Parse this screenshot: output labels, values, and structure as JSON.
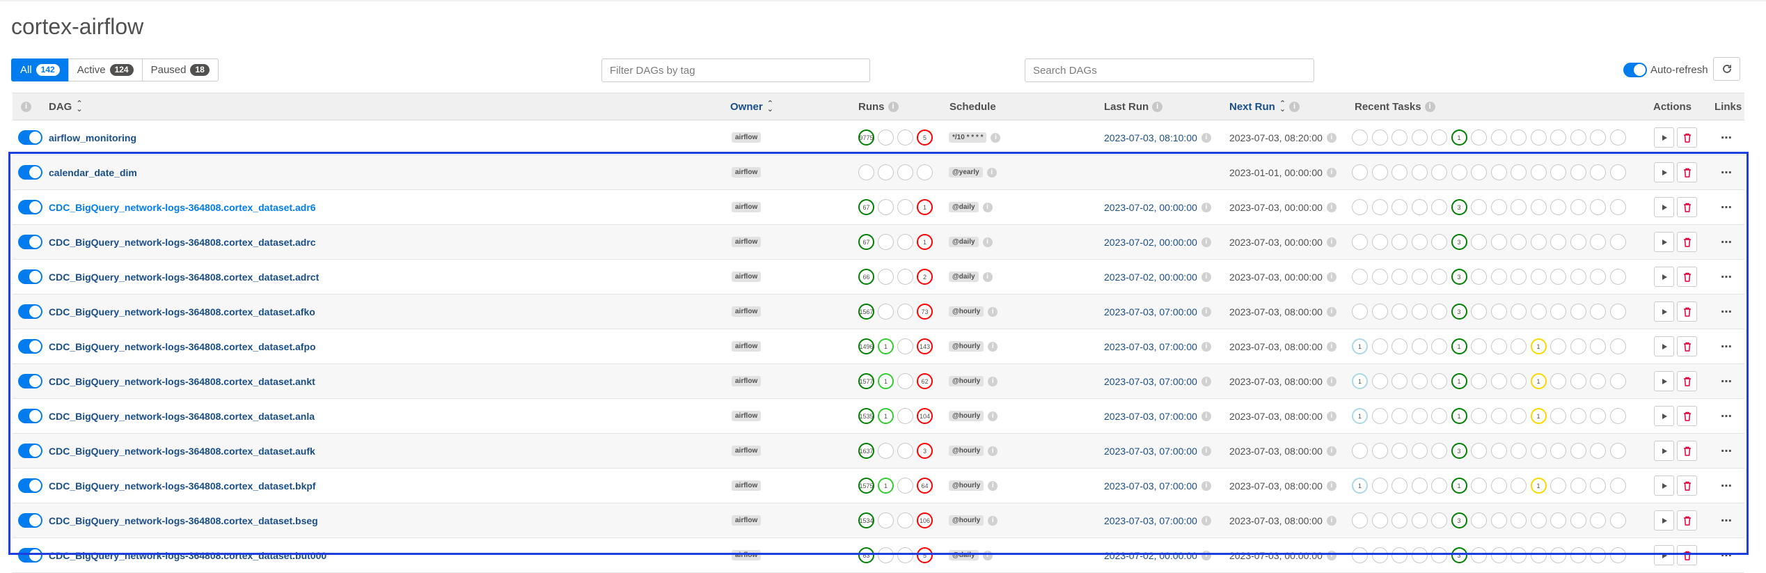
{
  "app": {
    "title": "cortex-airflow"
  },
  "filters": {
    "tabs": [
      {
        "label": "All",
        "count": "142",
        "active": true
      },
      {
        "label": "Active",
        "count": "124",
        "active": false
      },
      {
        "label": "Paused",
        "count": "18",
        "active": false
      }
    ],
    "tag_placeholder": "Filter DAGs by tag",
    "search_placeholder": "Search DAGs",
    "auto_refresh_label": "Auto-refresh"
  },
  "table": {
    "headers": {
      "dag": "DAG",
      "owner": "Owner",
      "runs": "Runs",
      "schedule": "Schedule",
      "last_run": "Last Run",
      "next_run": "Next Run",
      "recent_tasks": "Recent Tasks",
      "actions": "Actions",
      "links": "Links"
    },
    "rows": [
      {
        "dag": "airflow_monitoring",
        "owner": "airflow",
        "runs": [
          [
            "green",
            "9775"
          ],
          [
            "empty",
            ""
          ],
          [
            "empty",
            ""
          ],
          [
            "red",
            "5"
          ]
        ],
        "schedule": "*/10 * * * *",
        "last_run": "2023-07-03, 08:10:00",
        "next_run": "2023-07-03, 08:20:00",
        "tasks": [
          [
            5,
            "green",
            "1"
          ]
        ]
      },
      {
        "dag": "calendar_date_dim",
        "owner": "airflow",
        "runs": [
          [
            "empty",
            ""
          ],
          [
            "empty",
            ""
          ],
          [
            "empty",
            ""
          ],
          [
            "empty",
            ""
          ]
        ],
        "schedule": "@yearly",
        "last_run": "",
        "next_run": "2023-01-01, 00:00:00",
        "tasks": []
      },
      {
        "dag": "CDC_BigQuery_network-logs-364808.cortex_dataset.adr6",
        "owner": "airflow",
        "runs": [
          [
            "green",
            "67"
          ],
          [
            "empty",
            ""
          ],
          [
            "empty",
            ""
          ],
          [
            "red",
            "1"
          ]
        ],
        "schedule": "@daily",
        "last_run": "2023-07-02, 00:00:00",
        "next_run": "2023-07-03, 00:00:00",
        "tasks": [
          [
            5,
            "green",
            "3"
          ]
        ]
      },
      {
        "dag": "CDC_BigQuery_network-logs-364808.cortex_dataset.adrc",
        "owner": "airflow",
        "runs": [
          [
            "green",
            "67"
          ],
          [
            "empty",
            ""
          ],
          [
            "empty",
            ""
          ],
          [
            "red",
            "1"
          ]
        ],
        "schedule": "@daily",
        "last_run": "2023-07-02, 00:00:00",
        "next_run": "2023-07-03, 00:00:00",
        "tasks": [
          [
            5,
            "green",
            "3"
          ]
        ]
      },
      {
        "dag": "CDC_BigQuery_network-logs-364808.cortex_dataset.adrct",
        "owner": "airflow",
        "runs": [
          [
            "green",
            "66"
          ],
          [
            "empty",
            ""
          ],
          [
            "empty",
            ""
          ],
          [
            "red",
            "2"
          ]
        ],
        "schedule": "@daily",
        "last_run": "2023-07-02, 00:00:00",
        "next_run": "2023-07-03, 00:00:00",
        "tasks": [
          [
            5,
            "green",
            "3"
          ]
        ]
      },
      {
        "dag": "CDC_BigQuery_network-logs-364808.cortex_dataset.afko",
        "owner": "airflow",
        "runs": [
          [
            "green",
            "1567"
          ],
          [
            "empty",
            ""
          ],
          [
            "empty",
            ""
          ],
          [
            "red",
            "73"
          ]
        ],
        "schedule": "@hourly",
        "last_run": "2023-07-03, 07:00:00",
        "next_run": "2023-07-03, 08:00:00",
        "tasks": [
          [
            5,
            "green",
            "3"
          ]
        ]
      },
      {
        "dag": "CDC_BigQuery_network-logs-364808.cortex_dataset.afpo",
        "owner": "airflow",
        "runs": [
          [
            "green",
            "1496"
          ],
          [
            "lime",
            "1"
          ],
          [
            "empty",
            ""
          ],
          [
            "red",
            "143"
          ]
        ],
        "schedule": "@hourly",
        "last_run": "2023-07-03, 07:00:00",
        "next_run": "2023-07-03, 08:00:00",
        "tasks": [
          [
            0,
            "blue",
            "1"
          ],
          [
            5,
            "green",
            "1"
          ],
          [
            9,
            "gold",
            "1"
          ]
        ]
      },
      {
        "dag": "CDC_BigQuery_network-logs-364808.cortex_dataset.ankt",
        "owner": "airflow",
        "runs": [
          [
            "green",
            "1577"
          ],
          [
            "lime",
            "1"
          ],
          [
            "empty",
            ""
          ],
          [
            "red",
            "62"
          ]
        ],
        "schedule": "@hourly",
        "last_run": "2023-07-03, 07:00:00",
        "next_run": "2023-07-03, 08:00:00",
        "tasks": [
          [
            0,
            "blue",
            "1"
          ],
          [
            5,
            "green",
            "1"
          ],
          [
            9,
            "gold",
            "1"
          ]
        ]
      },
      {
        "dag": "CDC_BigQuery_network-logs-364808.cortex_dataset.anla",
        "owner": "airflow",
        "runs": [
          [
            "green",
            "1535"
          ],
          [
            "lime",
            "1"
          ],
          [
            "empty",
            ""
          ],
          [
            "red",
            "104"
          ]
        ],
        "schedule": "@hourly",
        "last_run": "2023-07-03, 07:00:00",
        "next_run": "2023-07-03, 08:00:00",
        "tasks": [
          [
            0,
            "blue",
            "1"
          ],
          [
            5,
            "green",
            "1"
          ],
          [
            9,
            "gold",
            "1"
          ]
        ]
      },
      {
        "dag": "CDC_BigQuery_network-logs-364808.cortex_dataset.aufk",
        "owner": "airflow",
        "runs": [
          [
            "green",
            "1637"
          ],
          [
            "empty",
            ""
          ],
          [
            "empty",
            ""
          ],
          [
            "red",
            "3"
          ]
        ],
        "schedule": "@hourly",
        "last_run": "2023-07-03, 07:00:00",
        "next_run": "2023-07-03, 08:00:00",
        "tasks": [
          [
            5,
            "green",
            "3"
          ]
        ]
      },
      {
        "dag": "CDC_BigQuery_network-logs-364808.cortex_dataset.bkpf",
        "owner": "airflow",
        "runs": [
          [
            "green",
            "1575"
          ],
          [
            "lime",
            "1"
          ],
          [
            "empty",
            ""
          ],
          [
            "red",
            "64"
          ]
        ],
        "schedule": "@hourly",
        "last_run": "2023-07-03, 07:00:00",
        "next_run": "2023-07-03, 08:00:00",
        "tasks": [
          [
            0,
            "blue",
            "1"
          ],
          [
            5,
            "green",
            "1"
          ],
          [
            9,
            "gold",
            "1"
          ]
        ]
      },
      {
        "dag": "CDC_BigQuery_network-logs-364808.cortex_dataset.bseg",
        "owner": "airflow",
        "runs": [
          [
            "green",
            "1534"
          ],
          [
            "empty",
            ""
          ],
          [
            "empty",
            ""
          ],
          [
            "red",
            "106"
          ]
        ],
        "schedule": "@hourly",
        "last_run": "2023-07-03, 07:00:00",
        "next_run": "2023-07-03, 08:00:00",
        "tasks": [
          [
            5,
            "green",
            "3"
          ]
        ]
      },
      {
        "dag": "CDC_BigQuery_network-logs-364808.cortex_dataset.but000",
        "owner": "airflow",
        "runs": [
          [
            "green",
            "63"
          ],
          [
            "empty",
            ""
          ],
          [
            "empty",
            ""
          ],
          [
            "red",
            "5"
          ]
        ],
        "schedule": "@daily",
        "last_run": "2023-07-02, 00:00:00",
        "next_run": "2023-07-03, 00:00:00",
        "tasks": [
          [
            5,
            "green",
            "3"
          ]
        ]
      }
    ]
  },
  "colors": {
    "accent": "#017cee",
    "success": "#008000",
    "failed": "#ff0000",
    "running": "#32cd32",
    "up_for_retry": "#ffd700",
    "scheduled": "#add8e6",
    "selection_box": "#1f3ee0"
  },
  "icons": {
    "info": "info-icon",
    "sort": "sort-icon",
    "refresh": "refresh-icon",
    "trigger": "play-icon",
    "delete": "trash-icon",
    "links": "more-icon"
  }
}
